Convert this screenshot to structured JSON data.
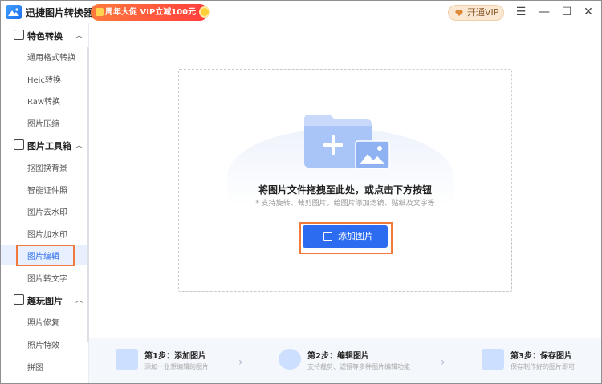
{
  "app": {
    "title": "迅捷图片转换器",
    "promo": "周年大促 VIP立减100元",
    "vip_button": "开通VIP",
    "window_controls": {
      "menu": "☰",
      "minimize": "—",
      "maximize": "☐",
      "close": "✕"
    }
  },
  "sidebar": {
    "categories": [
      {
        "label": "特色转换",
        "icon": "format-icon",
        "chevron": "︿",
        "items": [
          "通用格式转换",
          "Heic转换",
          "Raw转换",
          "图片压缩"
        ]
      },
      {
        "label": "图片工具箱",
        "icon": "toolbox-icon",
        "chevron": "︿",
        "items": [
          "抠图换背景",
          "智能证件照",
          "图片去水印",
          "图片加水印",
          "图片编辑",
          "图片转文字"
        ]
      },
      {
        "label": "趣玩图片",
        "icon": "image-fun-icon",
        "chevron": "︿",
        "items": [
          "照片修复",
          "照片特效",
          "拼图"
        ]
      }
    ],
    "active_item": "图片编辑"
  },
  "dropzone": {
    "title": "将图片文件拖拽至此处，或点击下方按钮",
    "subtitle": "* 支持旋转、裁剪图片，给图片添加滤镜、贴纸及文字等",
    "add_button": "添加图片"
  },
  "steps": [
    {
      "title": "第1步：添加图片",
      "desc": "添加一张想编辑的图片",
      "icon": "add-image-icon"
    },
    {
      "title": "第2步：编辑图片",
      "desc": "支持裁剪、滤镜等多种图片编辑功能",
      "icon": "gear-icon"
    },
    {
      "title": "第3步：保存图片",
      "desc": "保存制作好的图片即可",
      "icon": "save-image-icon"
    }
  ],
  "colors": {
    "accent": "#2c6cf0",
    "highlight": "#f07a3b",
    "promo": "#ff4d3d"
  }
}
